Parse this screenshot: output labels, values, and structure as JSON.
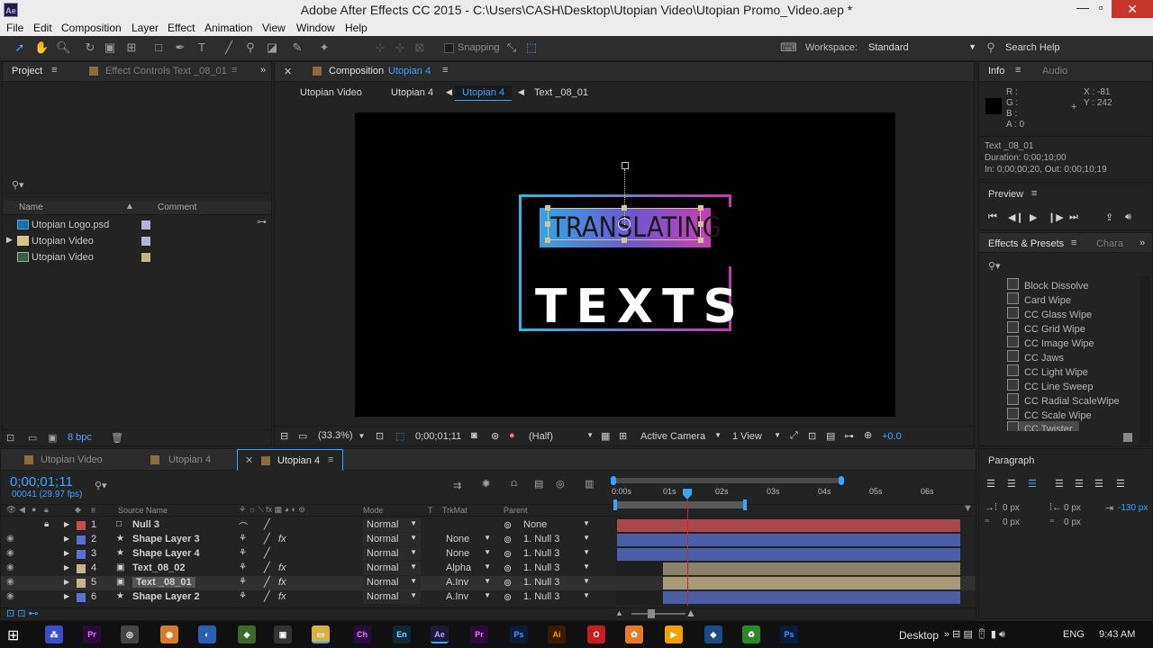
{
  "window": {
    "title": "Adobe After Effects CC 2015 - C:\\Users\\CASH\\Desktop\\Utopian Video\\Utopian Promo_Video.aep *",
    "logo": "Ae"
  },
  "menu": [
    "File",
    "Edit",
    "Composition",
    "Layer",
    "Effect",
    "Animation",
    "View",
    "Window",
    "Help"
  ],
  "toolbar": {
    "snapping": "Snapping",
    "workspace_label": "Workspace:",
    "workspace_value": "Standard",
    "search_help": "Search Help"
  },
  "project": {
    "tab_project": "Project",
    "tab_effect_controls": "Effect Controls Text _08_01",
    "col_name": "Name",
    "col_comment": "Comment",
    "items": [
      {
        "name": "Utopian Logo.psd",
        "color": "#b4b4d8"
      },
      {
        "name": "Utopian Video",
        "color": "#b4b4d8"
      },
      {
        "name": "Utopian Video",
        "color": "#c9b48a"
      }
    ],
    "bpc": "8 bpc"
  },
  "composition": {
    "tab_label": "Composition",
    "tab_name": "Utopian 4",
    "breadcrumbs": [
      "Utopian Video",
      "Utopian 4",
      "Utopian 4",
      "Text _08_01"
    ],
    "text_top": "TRANSLATING",
    "text_bottom": "TEXTS",
    "zoom": "(33.3%)",
    "timecode": "0;00;01;11",
    "resolution": "(Half)",
    "camera": "Active Camera",
    "view": "1 View",
    "exposure": "+0.0"
  },
  "info": {
    "tab_info": "Info",
    "tab_audio": "Audio",
    "r": "R :",
    "g": "G :",
    "b": "B :",
    "a": "A : 0",
    "x": "X : -81",
    "y": "Y : 242",
    "layer": "Text _08_01",
    "duration": "Duration: 0;00;10;00",
    "inout": "In: 0;00;00;20, Out: 0;00;10;19"
  },
  "preview": {
    "title": "Preview"
  },
  "effects": {
    "title": "Effects & Presets",
    "tab2": "Chara",
    "items": [
      "Block Dissolve",
      "Card Wipe",
      "CC Glass Wipe",
      "CC Grid Wipe",
      "CC Image Wipe",
      "CC Jaws",
      "CC Light Wipe",
      "CC Line Sweep",
      "CC Radial ScaleWipe",
      "CC Scale Wipe",
      "CC Twister"
    ]
  },
  "paragraph": {
    "title": "Paragraph",
    "indent_left": "0 px",
    "indent_right": "0 px",
    "first_line": "-130 px",
    "space_before": "0 px",
    "space_after": "0 px"
  },
  "timeline": {
    "tabs": [
      "Utopian Video",
      "Utopian 4",
      "Utopian 4"
    ],
    "current_time": "0;00;01;11",
    "frames": "00041 (29.97 fps)",
    "headers": {
      "num": "#",
      "source": "Source Name",
      "mode": "Mode",
      "t": "T",
      "trkmat": "TrkMat",
      "parent": "Parent"
    },
    "ruler": [
      "0:00s",
      "01s",
      "02s",
      "03s",
      "04s",
      "05s",
      "06s"
    ],
    "layers": [
      {
        "num": "1",
        "name": "Null 3",
        "color": "#c94b4b",
        "mode": "Normal",
        "trkmat": "",
        "parent": "None",
        "bar": "#a84848",
        "fx": false,
        "start": 0
      },
      {
        "num": "2",
        "name": "Shape Layer 3",
        "color": "#5b6fd6",
        "mode": "Normal",
        "trkmat": "None",
        "parent": "1. Null 3",
        "bar": "#4a5fa8",
        "fx": true,
        "start": 0
      },
      {
        "num": "3",
        "name": "Shape Layer 4",
        "color": "#5b6fd6",
        "mode": "Normal",
        "trkmat": "None",
        "parent": "1. Null 3",
        "bar": "#4a5fa8",
        "fx": false,
        "start": 0
      },
      {
        "num": "4",
        "name": "Text_08_02",
        "color": "#c9b48a",
        "mode": "Normal",
        "trkmat": "Alpha",
        "parent": "1. Null 3",
        "bar": "#8c826a",
        "fx": true,
        "start": 0.135
      },
      {
        "num": "5",
        "name": "Text _08_01",
        "color": "#c9b48a",
        "mode": "Normal",
        "trkmat": "A.Inv",
        "parent": "1. Null 3",
        "bar": "#a89a78",
        "fx": true,
        "start": 0.135
      },
      {
        "num": "6",
        "name": "Shape Layer 2",
        "color": "#5b6fd6",
        "mode": "Normal",
        "trkmat": "A.Inv",
        "parent": "1. Null 3",
        "bar": "#4a5fa8",
        "fx": true,
        "start": 0.135
      }
    ]
  },
  "taskbar": {
    "desktop": "Desktop",
    "lang": "ENG",
    "time": "9:43 AM"
  }
}
